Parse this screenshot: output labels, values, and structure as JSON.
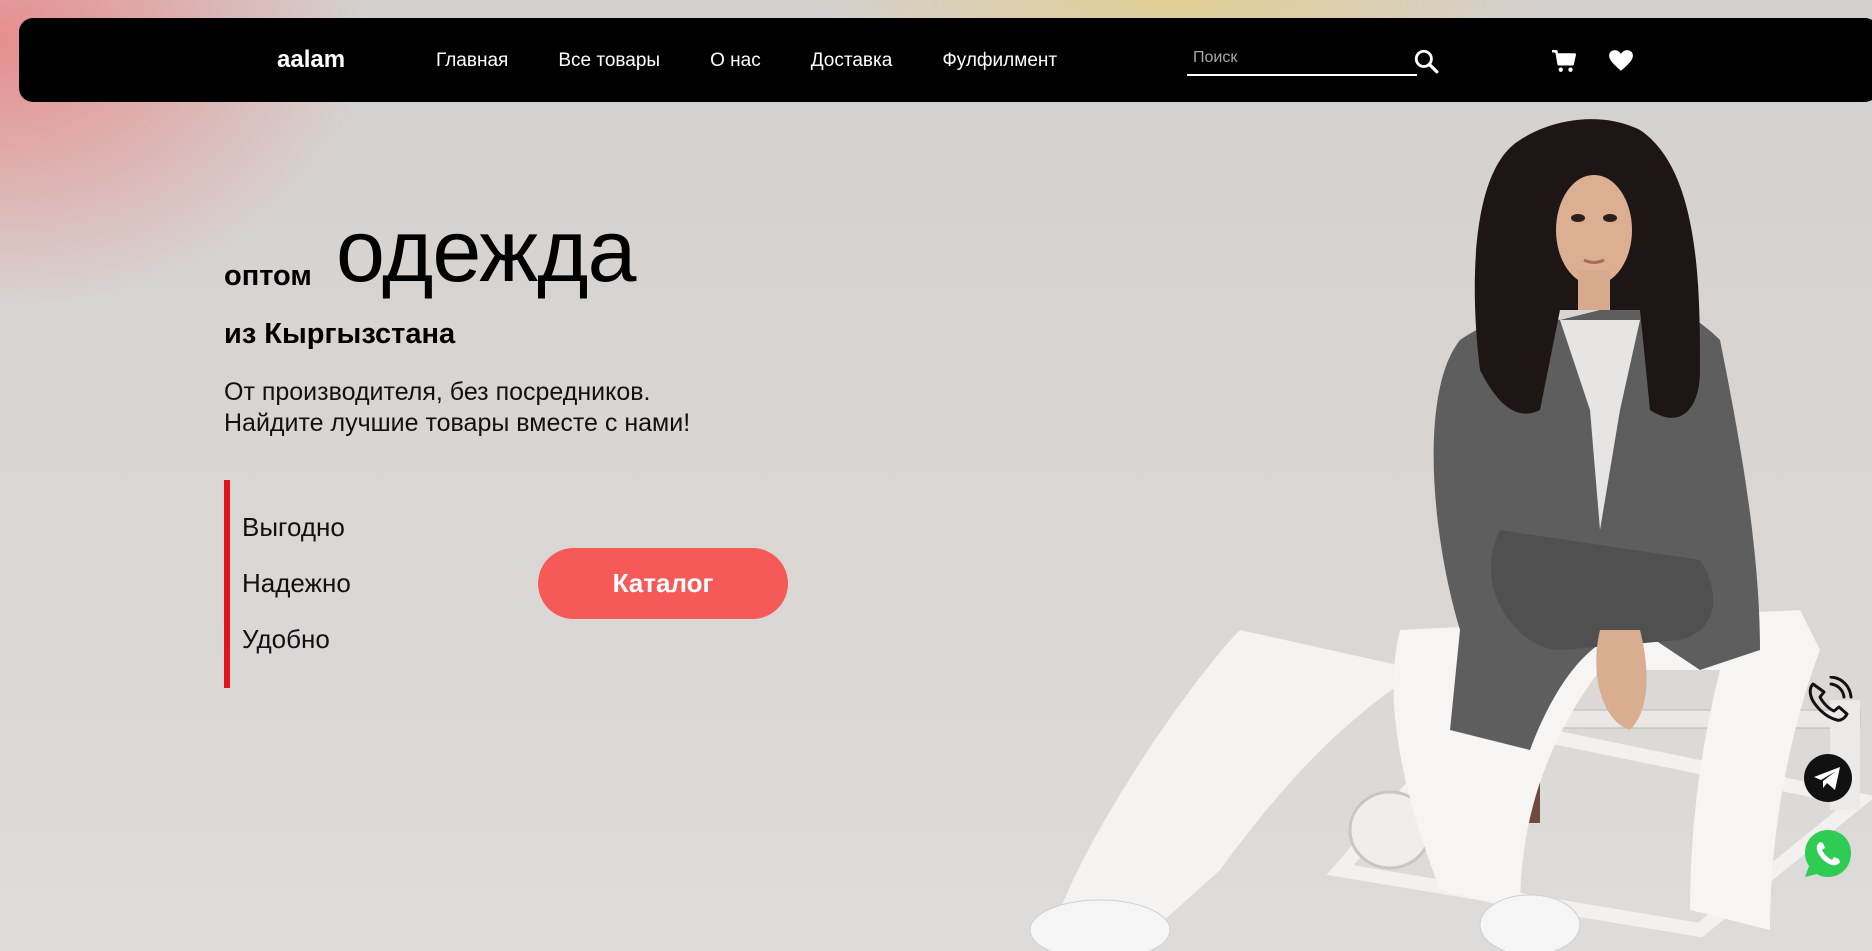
{
  "header": {
    "logo": "aalam",
    "nav": [
      "Главная",
      "Все товары",
      "О нас",
      "Доставка",
      "Фулфилмент"
    ],
    "search_placeholder": "Поиск",
    "icons": [
      "search-icon",
      "cart-icon",
      "heart-icon"
    ]
  },
  "hero": {
    "title_small": "оптом",
    "title_big": "одежда",
    "title_sub": "из Кыргызстана",
    "description": [
      "От производителя, без посредников.",
      "Найдите лучшие товары вместе с нами!"
    ],
    "features": [
      "Выгодно",
      "Надежно",
      "Удобно"
    ],
    "catalog_button": "Каталог"
  },
  "contacts": {
    "icons": [
      "phone-icon",
      "telegram-icon",
      "whatsapp-icon"
    ]
  },
  "colors": {
    "header_bg": "#000000",
    "accent_red": "#e0161c",
    "button": "#f65a58",
    "whatsapp": "#2ecc52"
  }
}
